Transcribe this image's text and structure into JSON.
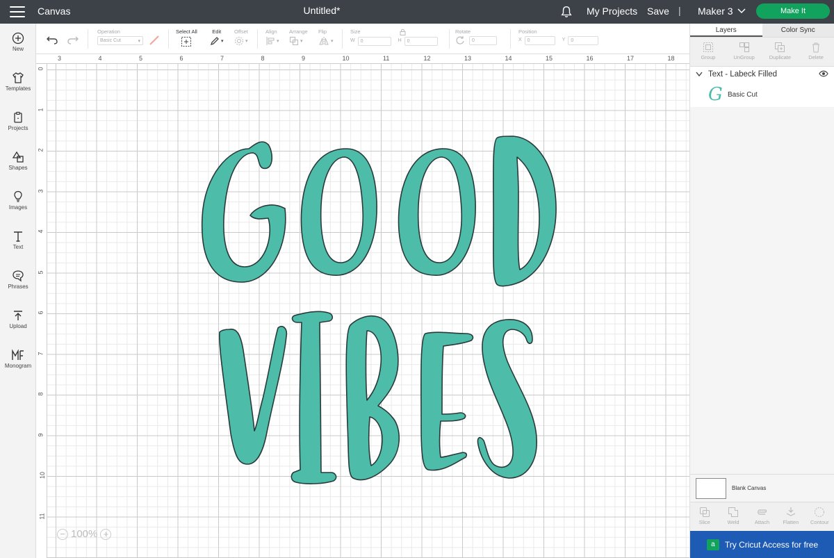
{
  "header": {
    "app_title": "Canvas",
    "doc_title": "Untitled*",
    "my_projects": "My Projects",
    "save": "Save",
    "separator": "|",
    "machine": "Maker 3",
    "make_it": "Make It"
  },
  "sidebar": {
    "items": [
      {
        "label": "New",
        "icon": "plus-circle-icon"
      },
      {
        "label": "Templates",
        "icon": "tshirt-icon"
      },
      {
        "label": "Projects",
        "icon": "clipboard-icon"
      },
      {
        "label": "Shapes",
        "icon": "shapes-icon"
      },
      {
        "label": "Images",
        "icon": "lightbulb-icon"
      },
      {
        "label": "Text",
        "icon": "text-t-icon"
      },
      {
        "label": "Phrases",
        "icon": "speech-bubble-icon"
      },
      {
        "label": "Upload",
        "icon": "upload-icon"
      },
      {
        "label": "Monogram",
        "icon": "monogram-icon"
      }
    ]
  },
  "toolbar": {
    "operation_label": "Operation",
    "operation_value": "Basic Cut",
    "select_all": "Select All",
    "edit": "Edit",
    "offset": "Offset",
    "align": "Align",
    "arrange": "Arrange",
    "flip": "Flip",
    "size": "Size",
    "w": "W",
    "h": "H",
    "size_w_value": "0",
    "size_h_value": "0",
    "rotate": "Rotate",
    "rotate_value": "0",
    "position": "Position",
    "x": "X",
    "y": "Y",
    "pos_x_value": "0",
    "pos_y_value": "0"
  },
  "rulers": {
    "top": [
      "3",
      "4",
      "5",
      "6",
      "7",
      "8",
      "9",
      "10",
      "11",
      "12",
      "13",
      "14",
      "15",
      "16",
      "17",
      "18"
    ],
    "left": [
      "0",
      "1",
      "2",
      "3",
      "4",
      "5",
      "6",
      "7",
      "8",
      "9",
      "10",
      "11"
    ]
  },
  "canvas": {
    "line1": "GOOD",
    "line2": "VIBES",
    "fill_color": "#4dbca8",
    "outline_color": "#2a3a3a",
    "zoom": "100%"
  },
  "panel": {
    "tabs": [
      "Layers",
      "Color Sync"
    ],
    "actions": [
      "Group",
      "UnGroup",
      "Duplicate",
      "Delete"
    ],
    "layer_title": "Text - Labeck Filled",
    "layer_child_glyph": "G",
    "layer_child_label": "Basic Cut",
    "blank_canvas": "Blank Canvas",
    "bottom_actions": [
      "Slice",
      "Weld",
      "Attach",
      "Flatten",
      "Contour"
    ],
    "cricut_access": "Try Cricut Access for free",
    "cricut_access_icon": "a"
  }
}
